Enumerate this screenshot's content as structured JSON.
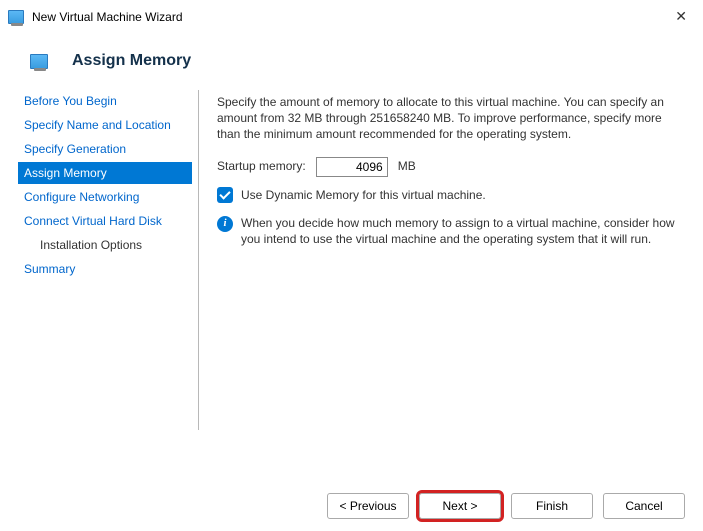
{
  "titlebar": {
    "title": "New Virtual Machine Wizard"
  },
  "header": {
    "title": "Assign Memory"
  },
  "sidebar": {
    "items": [
      {
        "label": "Before You Begin",
        "selected": false,
        "indent": false,
        "plain": false
      },
      {
        "label": "Specify Name and Location",
        "selected": false,
        "indent": false,
        "plain": false
      },
      {
        "label": "Specify Generation",
        "selected": false,
        "indent": false,
        "plain": false
      },
      {
        "label": "Assign Memory",
        "selected": true,
        "indent": false,
        "plain": false
      },
      {
        "label": "Configure Networking",
        "selected": false,
        "indent": false,
        "plain": false
      },
      {
        "label": "Connect Virtual Hard Disk",
        "selected": false,
        "indent": false,
        "plain": false
      },
      {
        "label": "Installation Options",
        "selected": false,
        "indent": true,
        "plain": true
      },
      {
        "label": "Summary",
        "selected": false,
        "indent": false,
        "plain": false
      }
    ]
  },
  "content": {
    "intro": "Specify the amount of memory to allocate to this virtual machine. You can specify an amount from 32 MB through 251658240 MB. To improve performance, specify more than the minimum amount recommended for the operating system.",
    "startup_label": "Startup memory:",
    "startup_value": "4096",
    "startup_unit": "MB",
    "dynamic_label": "Use Dynamic Memory for this virtual machine.",
    "info_text": "When you decide how much memory to assign to a virtual machine, consider how you intend to use the virtual machine and the operating system that it will run."
  },
  "footer": {
    "previous": "< Previous",
    "next": "Next >",
    "finish": "Finish",
    "cancel": "Cancel"
  }
}
